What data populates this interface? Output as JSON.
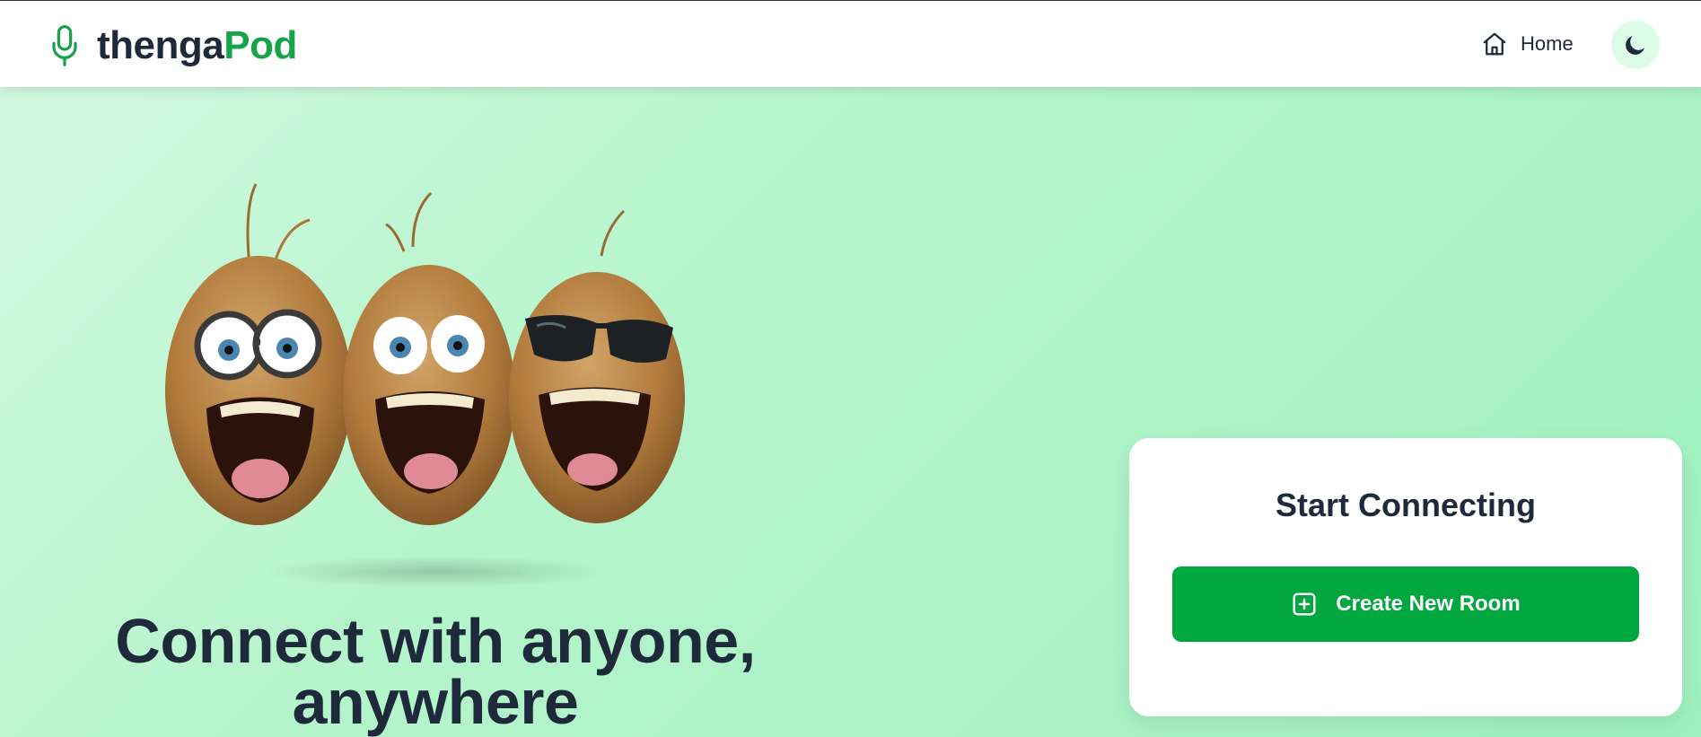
{
  "header": {
    "brand_part1": "thenga",
    "brand_part2": "Pod",
    "logo_icon": "microphone-icon",
    "nav_home_label": "Home",
    "home_icon": "home-icon",
    "theme_icon": "moon-icon"
  },
  "hero": {
    "title": "Connect with anyone, anywhere",
    "image": "three-cartoon-coconuts-illustration"
  },
  "card": {
    "title": "Start Connecting",
    "create_button_label": "Create New Room",
    "create_button_icon": "plus-square-icon"
  },
  "colors": {
    "brand_green": "#16a34a",
    "button_green": "#00a63e",
    "text_dark": "#1e293b",
    "toggle_bg": "#dcfce7"
  }
}
